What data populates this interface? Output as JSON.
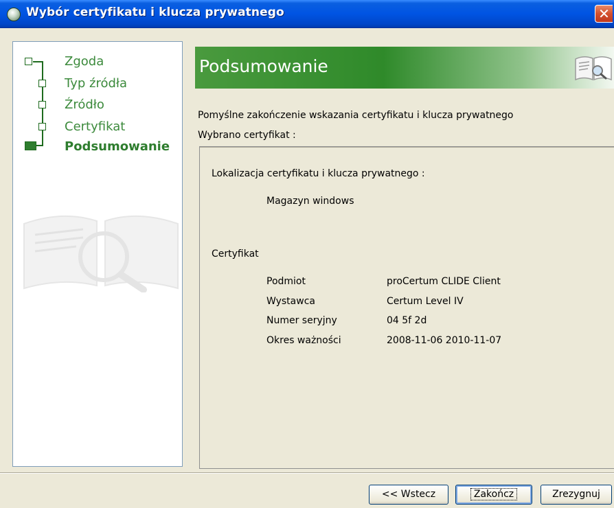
{
  "window": {
    "title": "Wybór certyfikatu i klucza prywatnego",
    "close_label": "✕"
  },
  "steps": [
    {
      "label": "Zgoda",
      "active": false
    },
    {
      "label": "Typ źródła",
      "active": false
    },
    {
      "label": "Źródło",
      "active": false
    },
    {
      "label": "Certyfikat",
      "active": false
    },
    {
      "label": "Podsumowanie",
      "active": true
    }
  ],
  "header": {
    "title": "Podsumowanie",
    "icon": "book-magnifier-icon"
  },
  "content": {
    "intro_line1": "Pomyślne zakończenie wskazania certyfikatu i klucza prywatnego",
    "intro_line2": "Wybrano certyfikat :",
    "location_label": "Lokalizacja certyfikatu i klucza prywatnego :",
    "location_value": "Magazyn windows",
    "cert_heading": "Certyfikat",
    "cert_fields": [
      {
        "label": "Podmiot",
        "value": "proCertum CLIDE Client"
      },
      {
        "label": "Wystawca",
        "value": "Certum Level IV"
      },
      {
        "label": "Numer seryjny",
        "value": "04 5f 2d"
      },
      {
        "label": "Okres ważności",
        "value": "2008-11-06 2010-11-07"
      }
    ]
  },
  "buttons": {
    "back": "<< Wstecz",
    "finish": "Zakończ",
    "cancel": "Zrezygnuj"
  },
  "colors": {
    "title_bar": "#0054e3",
    "accent_green": "#2e7d2e",
    "close_red": "#d3502e"
  }
}
